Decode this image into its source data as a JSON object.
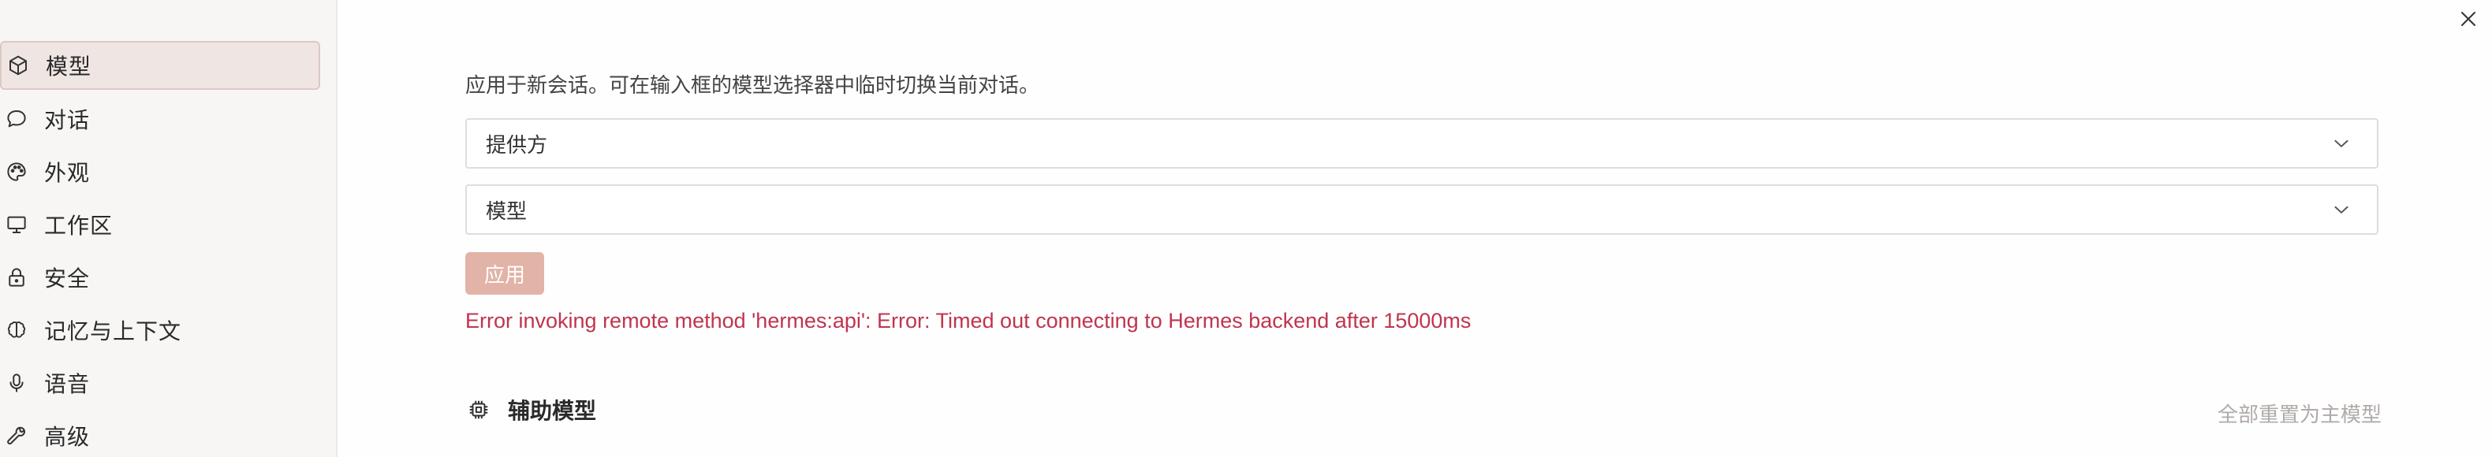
{
  "window": {
    "close_icon": "close-icon"
  },
  "sidebar": {
    "items": [
      {
        "label": "模型",
        "icon": "cube-icon",
        "active": true
      },
      {
        "label": "对话",
        "icon": "chat-bubble-icon",
        "active": false
      },
      {
        "label": "外观",
        "icon": "palette-icon",
        "active": false
      },
      {
        "label": "工作区",
        "icon": "monitor-icon",
        "active": false
      },
      {
        "label": "安全",
        "icon": "lock-icon",
        "active": false
      },
      {
        "label": "记忆与上下文",
        "icon": "brain-icon",
        "active": false
      },
      {
        "label": "语音",
        "icon": "microphone-icon",
        "active": false
      },
      {
        "label": "高级",
        "icon": "wrench-icon",
        "active": false
      }
    ]
  },
  "main": {
    "description": "应用于新会话。可在输入框的模型选择器中临时切换当前对话。",
    "provider_select": {
      "value": "提供方"
    },
    "model_select": {
      "value": "模型"
    },
    "apply_label": "应用",
    "error_message": "Error invoking remote method 'hermes:api': Error: Timed out connecting to Hermes backend after 15000ms",
    "aux_section": {
      "title": "辅助模型",
      "icon": "chip-icon",
      "reset_label": "全部重置为主模型"
    }
  },
  "colors": {
    "accent_active_bg": "#efe6e3",
    "apply_button": "#e2b3a7",
    "error": "#c0344e"
  }
}
